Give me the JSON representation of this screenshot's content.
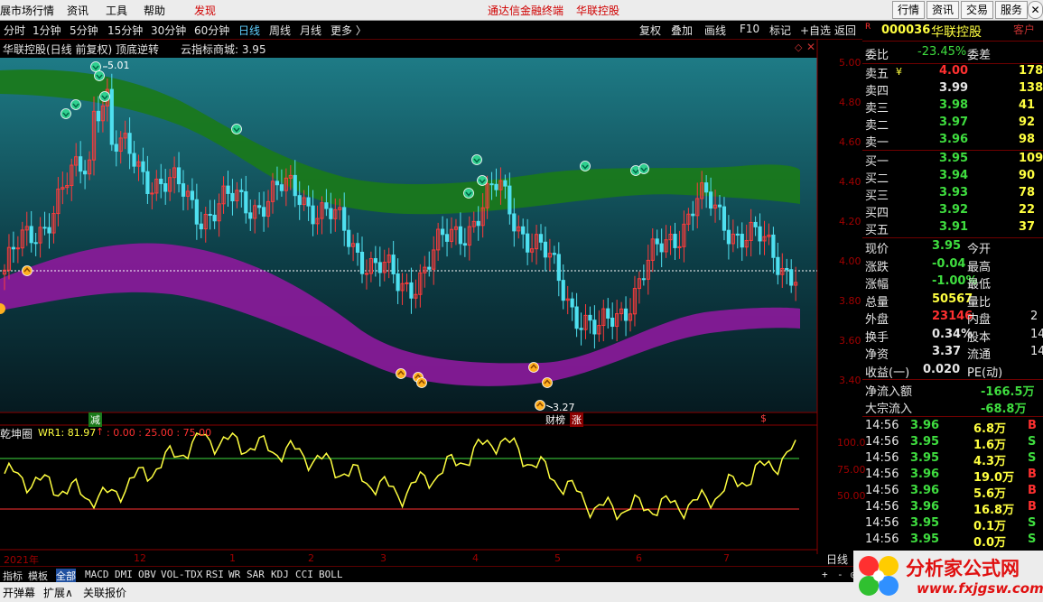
{
  "menubar": {
    "items": [
      "展市场行情",
      "资讯",
      "工具",
      "帮助",
      "发现"
    ],
    "center_links": [
      "通达信金融终端",
      "华联控股"
    ],
    "right_buttons": [
      "行情",
      "资讯",
      "交易",
      "服务"
    ],
    "window_close": "✕"
  },
  "toolbar": {
    "timeframes": [
      "分时",
      "1分钟",
      "5分钟",
      "15分钟",
      "30分钟",
      "60分钟",
      "日线",
      "周线",
      "月线",
      "更多 〉"
    ],
    "active": "日线",
    "buttons": [
      "复权",
      "叠加",
      "画线",
      "F10",
      "标记",
      "+自选",
      "返回"
    ]
  },
  "chart": {
    "title": "华联控股(日线 前复权) 顶底逆转",
    "cloud_label": "云指标商城: 3.95",
    "high_label": "5.01",
    "low_label": "3.27",
    "price_ticks": [
      "5.00",
      "4.80",
      "4.60",
      "4.40",
      "4.20",
      "4.00",
      "3.80",
      "3.60",
      "3.40"
    ],
    "event_labels": [
      "减",
      "财榜",
      "涨",
      "$"
    ],
    "osc_title": "乾坤圈",
    "osc_params": "WR1: 81.97",
    "osc_levels": ": 0.00 : 25.00 : 75.00",
    "osc_ticks": [
      "100.0",
      "75.00",
      "50.00"
    ],
    "date_labels": [
      "2021年",
      "12",
      "1",
      "2",
      "3",
      "4",
      "5",
      "6",
      "7"
    ],
    "period_label": "日线",
    "colors": {
      "green_band": "#1a7a1a",
      "purple_band": "#8a1a9a",
      "up_candle": "#ff3b3b",
      "down_candle": "#4fe0f0",
      "wr_line": "#ffff40"
    }
  },
  "chart_data": {
    "type": "line",
    "title": "华联控股(日线 前复权) 顶底逆转",
    "xlabel": "",
    "ylabel": "",
    "x": [
      "2021-11",
      "2021-12",
      "2022-01",
      "2022-02",
      "2022-03",
      "2022-04",
      "2022-05",
      "2022-06",
      "2022-07"
    ],
    "ylim": [
      3.27,
      5.01
    ],
    "series": [
      {
        "name": "close",
        "values": [
          3.95,
          4.6,
          4.25,
          4.35,
          3.85,
          4.35,
          3.6,
          4.3,
          3.95
        ]
      },
      {
        "name": "WR1",
        "values": [
          60,
          35,
          95,
          80,
          40,
          95,
          25,
          30,
          82
        ]
      }
    ],
    "high": 5.01,
    "low": 3.27,
    "last_price": 3.95,
    "wr1": 81.97
  },
  "quote": {
    "flag": "R",
    "code": "000036",
    "name": "华联控股",
    "corner": "客户",
    "weibi_label": "委比",
    "weibi_val": "-23.45%",
    "weicha_label": "委差",
    "asks": [
      {
        "label": "卖五",
        "price": "4.00",
        "vol": "178"
      },
      {
        "label": "卖四",
        "price": "3.99",
        "vol": "138"
      },
      {
        "label": "卖三",
        "price": "3.98",
        "vol": "41"
      },
      {
        "label": "卖二",
        "price": "3.97",
        "vol": "92"
      },
      {
        "label": "卖一",
        "price": "3.96",
        "vol": "98"
      }
    ],
    "ask_mark": "¥",
    "bids": [
      {
        "label": "买一",
        "price": "3.95",
        "vol": "109"
      },
      {
        "label": "买二",
        "price": "3.94",
        "vol": "90"
      },
      {
        "label": "买三",
        "price": "3.93",
        "vol": "78"
      },
      {
        "label": "买四",
        "price": "3.92",
        "vol": "22"
      },
      {
        "label": "买五",
        "price": "3.91",
        "vol": "37"
      }
    ],
    "stats": [
      {
        "l": "现价",
        "v": "3.95",
        "l2": "今开"
      },
      {
        "l": "涨跌",
        "v": "-0.04",
        "l2": "最高"
      },
      {
        "l": "涨幅",
        "v": "-1.00%",
        "l2": "最低"
      },
      {
        "l": "总量",
        "v": "50567",
        "l2": "量比"
      },
      {
        "l": "外盘",
        "v": "23146",
        "l2": "内盘",
        "v2": "2"
      },
      {
        "l": "换手",
        "v": "0.34%",
        "l2": "股本",
        "v2": "14"
      },
      {
        "l": "净资",
        "v": "3.37",
        "l2": "流通",
        "v2": "14"
      },
      {
        "l": "收益(一)",
        "v": "0.020",
        "l2": "PE(动)"
      }
    ],
    "flows": [
      {
        "l": "净流入额",
        "v": "-166.5万"
      },
      {
        "l": "大宗流入",
        "v": "-68.8万"
      }
    ],
    "ticks": [
      {
        "t": "14:56",
        "p": "3.96",
        "v": "6.8万",
        "s": "B"
      },
      {
        "t": "14:56",
        "p": "3.95",
        "v": "1.6万",
        "s": "S"
      },
      {
        "t": "14:56",
        "p": "3.95",
        "v": "4.3万",
        "s": "S"
      },
      {
        "t": "14:56",
        "p": "3.96",
        "v": "19.0万",
        "s": "B"
      },
      {
        "t": "14:56",
        "p": "3.96",
        "v": "5.6万",
        "s": "B"
      },
      {
        "t": "14:56",
        "p": "3.96",
        "v": "16.8万",
        "s": "B"
      },
      {
        "t": "14:56",
        "p": "3.95",
        "v": "0.1万",
        "s": "S"
      },
      {
        "t": "14:56",
        "p": "3.95",
        "v": "0.0万",
        "s": "S"
      }
    ]
  },
  "bottom": {
    "tabs": [
      "指标",
      "模板",
      "全部",
      "MACD",
      "DMI",
      "OBV",
      "VOL-TDX",
      "RSI",
      "WR",
      "SAR",
      "KDJ",
      "CCI",
      "BOLL"
    ],
    "selected": "全部",
    "extra": [
      "开弹幕",
      "扩展∧",
      "关联报价"
    ],
    "zoom": [
      "+",
      "-",
      "◎"
    ]
  },
  "logo": {
    "cn": "分析家公式网",
    "url": "www.fxjgsw.com"
  }
}
